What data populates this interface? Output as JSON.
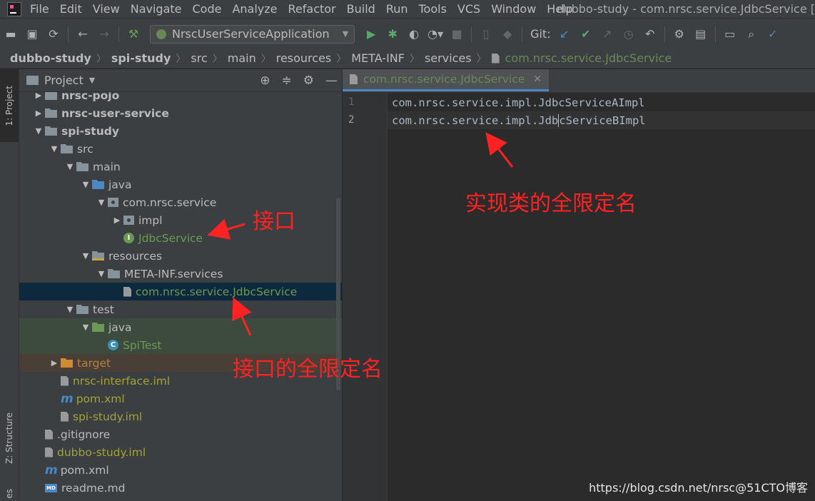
{
  "menu": {
    "items": [
      "File",
      "Edit",
      "View",
      "Navigate",
      "Code",
      "Analyze",
      "Refactor",
      "Build",
      "Run",
      "Tools",
      "VCS",
      "Window",
      "Help"
    ],
    "window_title": "dubbo-study - com.nrsc.service.JdbcService ["
  },
  "toolbar": {
    "run_config": "NrscUserServiceApplication",
    "git_label": "Git:",
    "icons": [
      "folder-icon",
      "save-icon",
      "sync-icon",
      "back-icon",
      "forward-icon",
      "build-hammer-icon",
      "run-icon",
      "debug-icon",
      "coverage-icon",
      "profile-icon",
      "stop-icon",
      "device-icon",
      "structure-icon",
      "git-update-icon",
      "git-commit-icon",
      "git-push-icon",
      "history-icon",
      "revert-icon",
      "settings-wrench-icon",
      "project-structure-icon",
      "terminal-icon",
      "search-icon",
      "accept-icon"
    ]
  },
  "breadcrumbs": {
    "items": [
      "dubbo-study",
      "spi-study",
      "src",
      "main",
      "resources",
      "META-INF",
      "services"
    ],
    "file": "com.nrsc.service.JdbcService"
  },
  "side_tabs": {
    "project": "1: Project",
    "structure": "Z: Structure",
    "bottom": "es"
  },
  "project_panel": {
    "title": "Project",
    "tree": [
      {
        "label": "nrsc-pojo",
        "depth": 1,
        "arrow": "right",
        "icon": "folder",
        "color": "c-bold"
      },
      {
        "label": "nrsc-user-service",
        "depth": 1,
        "arrow": "right",
        "icon": "folder",
        "color": "c-bold"
      },
      {
        "label": "spi-study",
        "depth": 1,
        "arrow": "down",
        "icon": "folder",
        "color": "c-bold"
      },
      {
        "label": "src",
        "depth": 2,
        "arrow": "down",
        "icon": "folder",
        "color": "c-default"
      },
      {
        "label": "main",
        "depth": 3,
        "arrow": "down",
        "icon": "folder",
        "color": "c-default"
      },
      {
        "label": "java",
        "depth": 4,
        "arrow": "down",
        "icon": "folder-blue",
        "color": "c-default"
      },
      {
        "label": "com.nrsc.service",
        "depth": 5,
        "arrow": "down",
        "icon": "pkg",
        "color": "c-default"
      },
      {
        "label": "impl",
        "depth": 6,
        "arrow": "right",
        "icon": "pkg",
        "color": "c-default"
      },
      {
        "label": "JdbcService",
        "depth": 6,
        "arrow": "none",
        "icon": "interface",
        "color": "c-green"
      },
      {
        "label": "resources",
        "depth": 4,
        "arrow": "down",
        "icon": "folder-res",
        "color": "c-default"
      },
      {
        "label": "META-INF.services",
        "depth": 5,
        "arrow": "down",
        "icon": "folder",
        "color": "c-default"
      },
      {
        "label": "com.nrsc.service.JdbcService",
        "depth": 6,
        "arrow": "none",
        "icon": "file",
        "color": "c-green",
        "selected": true
      },
      {
        "label": "test",
        "depth": 3,
        "arrow": "down",
        "icon": "folder",
        "color": "c-default"
      },
      {
        "label": "java",
        "depth": 4,
        "arrow": "down",
        "icon": "folder-green",
        "color": "c-default",
        "bg": "test"
      },
      {
        "label": "SpiTest",
        "depth": 5,
        "arrow": "none",
        "icon": "class",
        "color": "c-green",
        "bg": "test"
      },
      {
        "label": "target",
        "depth": 2,
        "arrow": "right",
        "icon": "folder-orange",
        "color": "c-orange",
        "bg": "excluded"
      },
      {
        "label": "nrsc-interface.iml",
        "depth": 2,
        "arrow": "none",
        "icon": "file",
        "color": "c-olive"
      },
      {
        "label": "pom.xml",
        "depth": 2,
        "arrow": "none",
        "icon": "maven",
        "color": "c-olive"
      },
      {
        "label": "spi-study.iml",
        "depth": 2,
        "arrow": "none",
        "icon": "file",
        "color": "c-olive"
      },
      {
        "label": ".gitignore",
        "depth": 1,
        "arrow": "none",
        "icon": "file",
        "color": "c-default"
      },
      {
        "label": "dubbo-study.iml",
        "depth": 1,
        "arrow": "none",
        "icon": "file",
        "color": "c-olive"
      },
      {
        "label": "pom.xml",
        "depth": 1,
        "arrow": "none",
        "icon": "maven",
        "color": "c-default"
      },
      {
        "label": "readme.md",
        "depth": 1,
        "arrow": "none",
        "icon": "md",
        "color": "c-default"
      }
    ]
  },
  "editor": {
    "tab_label": "com.nrsc.service.JdbcService",
    "lines": [
      {
        "no": "1",
        "pre": "com.nrsc.service.impl.JdbcServiceAImpl",
        "post": ""
      },
      {
        "no": "2",
        "pre": "com.nrsc.service.impl.Jdb",
        "post": "cServiceBImpl",
        "current": true
      }
    ]
  },
  "annotations": {
    "impl_full_name": "实现类的全限定名",
    "interface": "接口",
    "interface_full_name": "接口的全限定名",
    "color": "#ff2222"
  },
  "watermark": "https://blog.csdn.net/nrsc@51CTO博客"
}
